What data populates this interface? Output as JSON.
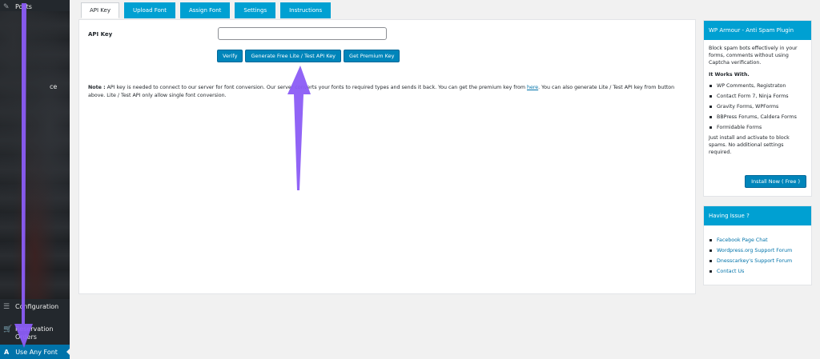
{
  "sidebar": {
    "posts_label": "Posts",
    "fragment_text": "ce",
    "config_label": "Configuration",
    "orders_label": "Reservation Orders",
    "active_label": "Use Any Font",
    "active_icon": "A"
  },
  "tabs": [
    {
      "label": "API Key",
      "active": true
    },
    {
      "label": "Upload Font",
      "active": false
    },
    {
      "label": "Assign Font",
      "active": false
    },
    {
      "label": "Settings",
      "active": false
    },
    {
      "label": "Instructions",
      "active": false
    }
  ],
  "main": {
    "api_key_label": "API Key",
    "api_key_value": "",
    "buttons": {
      "verify": "Verify",
      "generate": "Generate Free Lite / Test API Key",
      "premium": "Get Premium Key"
    },
    "note": {
      "lead": "Note :",
      "part1": " API key is needed to connect to our server for font conversion. Our server converts your fonts to required types and sends it back. You can get the premium key from ",
      "link": "here",
      "part2": ". You can also generate Lite / Test API key from button above. Lite / Test API only allow single font conversion."
    }
  },
  "widget_spam": {
    "title": "WP Armour - Anti Spam Plugin",
    "desc": "Block spam bots effectively in your forms, comments without using Captcha verification.",
    "subhead": "It Works With.",
    "items": [
      "WP Comments, Registraton",
      "Contact Form 7, Ninja Forms",
      "Gravity Forms, WPForms",
      "BBPress Forums, Caldera Forms",
      "Formidable Forms"
    ],
    "footer": "Just install and activate to block spams. No additional settings required.",
    "install_label": "Install Now ( Free )"
  },
  "widget_issue": {
    "title": "Having Issue ?",
    "links": [
      "Facebook Page Chat",
      "Wordpress.org Support Forum",
      "Dnesscarkey's Support Forum",
      "Contact Us"
    ]
  },
  "colors": {
    "accent": "#00a0d2",
    "button": "#0085ba",
    "sidebar": "#23282d",
    "arrow": "#8b5cf6"
  }
}
